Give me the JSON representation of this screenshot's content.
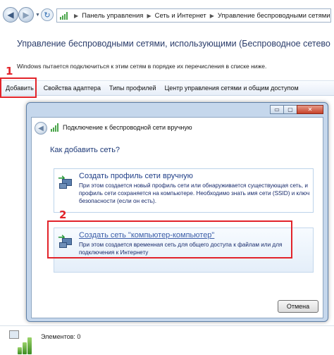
{
  "breadcrumb": {
    "items": [
      "Панель управления",
      "Сеть и Интернет",
      "Управление беспроводными сетями"
    ]
  },
  "page": {
    "title": "Управление беспроводными сетями, использующими (Беспроводное сетевое соединение",
    "description": "Windows пытается подключиться к этим сетям в порядке их перечисления в списке ниже."
  },
  "toolbar": {
    "items": [
      "Добавить",
      "Свойства адаптера",
      "Типы профилей",
      "Центр управления сетями и общим доступом"
    ]
  },
  "annotations": {
    "marker1": "1",
    "marker2": "2",
    "color": "#e2232a"
  },
  "dialog": {
    "header": "Подключение к беспроводной сети вручную",
    "question": "Как добавить сеть?",
    "options": [
      {
        "title": "Создать профиль сети вручную",
        "description": "При этом создается новый профиль сети или обнаруживается существующая сеть, и профиль сети сохраняется на компьютере. Необходимо знать имя сети (SSID) и ключ безопасности (если он есть)."
      },
      {
        "title": "Создать сеть \"компьютер-компьютер\"",
        "description": "При этом создается временная сеть для общего доступа к файлам или для подключения к Интернету"
      }
    ],
    "cancel_label": "Отмена",
    "window_buttons": {
      "minimize": "▭",
      "maximize": "▢",
      "close": "✕"
    }
  },
  "status": {
    "items_label": "Элементов: 0"
  },
  "icons": {
    "back": "back-arrow-icon",
    "forward": "forward-arrow-icon",
    "refresh": "refresh-icon",
    "signal": "wireless-signal-icon",
    "network_profile": "network-profile-icon"
  }
}
